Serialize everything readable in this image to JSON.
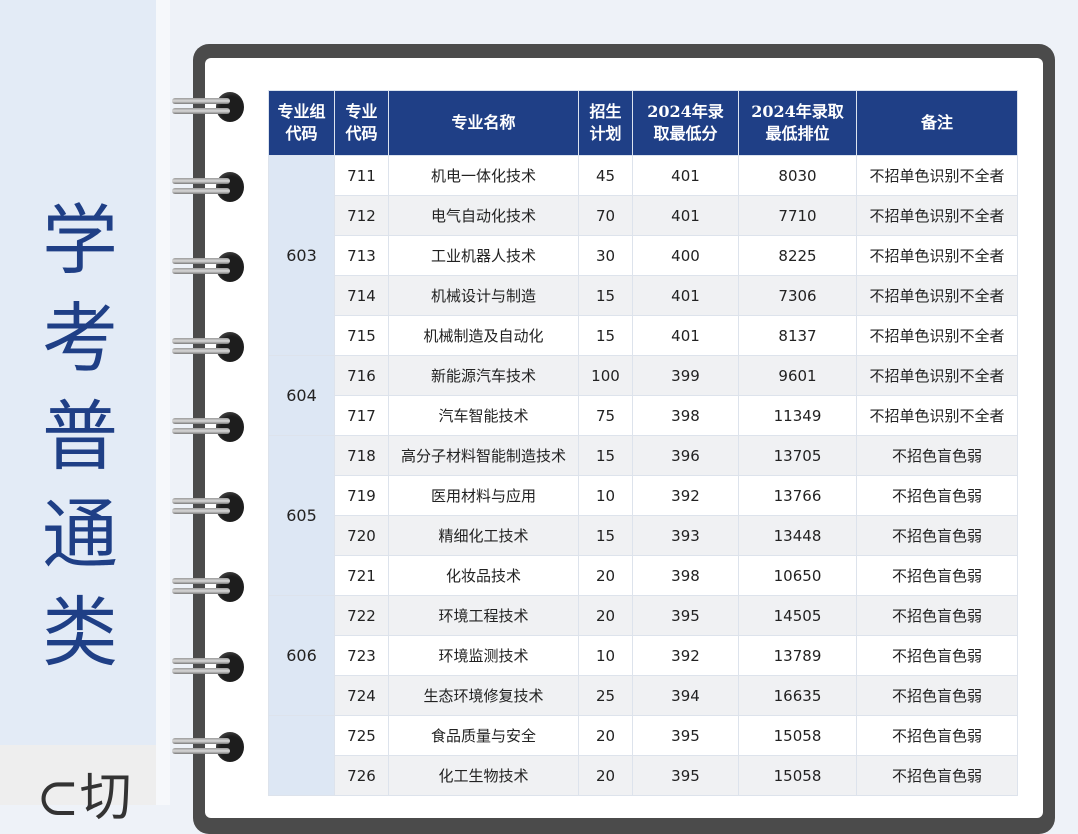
{
  "sidebar": {
    "title_chars": [
      "学",
      "考",
      "普",
      "通",
      "类"
    ],
    "bottom_text": "⊂切"
  },
  "table": {
    "headers": [
      {
        "line1": "专业组",
        "line2": "代码"
      },
      {
        "line1": "专业",
        "line2": "代码"
      },
      {
        "line1": "专业名称",
        "line2": ""
      },
      {
        "line1": "招生",
        "line2": "计划"
      },
      {
        "line1": "2024年录",
        "line2": "取最低分"
      },
      {
        "line1": "2024年录取",
        "line2": "最低排位"
      },
      {
        "line1": "备注",
        "line2": ""
      }
    ],
    "groups": [
      {
        "code": "603",
        "rows": [
          {
            "code": "711",
            "name": "机电一体化技术",
            "plan": "45",
            "min_score": "401",
            "min_rank": "8030",
            "note": "不招单色识别不全者"
          },
          {
            "code": "712",
            "name": "电气自动化技术",
            "plan": "70",
            "min_score": "401",
            "min_rank": "7710",
            "note": "不招单色识别不全者"
          },
          {
            "code": "713",
            "name": "工业机器人技术",
            "plan": "30",
            "min_score": "400",
            "min_rank": "8225",
            "note": "不招单色识别不全者"
          },
          {
            "code": "714",
            "name": "机械设计与制造",
            "plan": "15",
            "min_score": "401",
            "min_rank": "7306",
            "note": "不招单色识别不全者"
          },
          {
            "code": "715",
            "name": "机械制造及自动化",
            "plan": "15",
            "min_score": "401",
            "min_rank": "8137",
            "note": "不招单色识别不全者"
          }
        ]
      },
      {
        "code": "604",
        "rows": [
          {
            "code": "716",
            "name": "新能源汽车技术",
            "plan": "100",
            "min_score": "399",
            "min_rank": "9601",
            "note": "不招单色识别不全者"
          },
          {
            "code": "717",
            "name": "汽车智能技术",
            "plan": "75",
            "min_score": "398",
            "min_rank": "11349",
            "note": "不招单色识别不全者"
          }
        ]
      },
      {
        "code": "605",
        "rows": [
          {
            "code": "718",
            "name": "高分子材料智能制造技术",
            "plan": "15",
            "min_score": "396",
            "min_rank": "13705",
            "note": "不招色盲色弱"
          },
          {
            "code": "719",
            "name": "医用材料与应用",
            "plan": "10",
            "min_score": "392",
            "min_rank": "13766",
            "note": "不招色盲色弱"
          },
          {
            "code": "720",
            "name": "精细化工技术",
            "plan": "15",
            "min_score": "393",
            "min_rank": "13448",
            "note": "不招色盲色弱"
          },
          {
            "code": "721",
            "name": "化妆品技术",
            "plan": "20",
            "min_score": "398",
            "min_rank": "10650",
            "note": "不招色盲色弱"
          }
        ]
      },
      {
        "code": "606",
        "rows": [
          {
            "code": "722",
            "name": "环境工程技术",
            "plan": "20",
            "min_score": "395",
            "min_rank": "14505",
            "note": "不招色盲色弱"
          },
          {
            "code": "723",
            "name": "环境监测技术",
            "plan": "10",
            "min_score": "392",
            "min_rank": "13789",
            "note": "不招色盲色弱"
          },
          {
            "code": "724",
            "name": "生态环境修复技术",
            "plan": "25",
            "min_score": "394",
            "min_rank": "16635",
            "note": "不招色盲色弱"
          }
        ]
      },
      {
        "code": "",
        "rows": [
          {
            "code": "725",
            "name": "食品质量与安全",
            "plan": "20",
            "min_score": "395",
            "min_rank": "15058",
            "note": "不招色盲色弱"
          },
          {
            "code": "726",
            "name": "化工生物技术",
            "plan": "20",
            "min_score": "395",
            "min_rank": "15058",
            "note": "不招色盲色弱"
          }
        ]
      }
    ]
  },
  "colors": {
    "header_bg": "#1f3f86",
    "title_color": "#1f3f86",
    "group_cell_bg": "#dde7f4",
    "row_alt_bg": "#f0f1f3"
  }
}
